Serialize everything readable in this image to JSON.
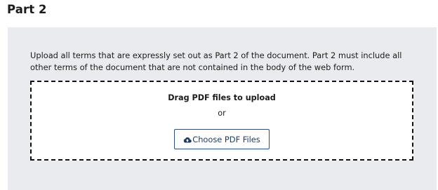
{
  "section": {
    "title": "Part 2"
  },
  "upload": {
    "instructions": "Upload all terms that are expressly set out as Part 2 of the document. Part 2 must include all other terms of the document that are not contained in the body of the web form.",
    "drag_text": "Drag PDF files to upload",
    "or_text": "or",
    "button_label": "Choose PDF Files",
    "button_icon": "cloud-upload-icon"
  },
  "colors": {
    "panel_bg": "#e9ebef",
    "button_border": "#2f4f7a",
    "button_text": "#1f3a5f"
  }
}
